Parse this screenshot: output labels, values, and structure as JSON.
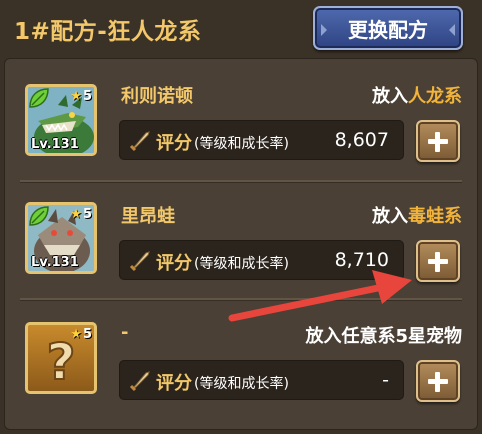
{
  "header": {
    "title": "1#配方-狂人龙系",
    "switch_button": "更换配方"
  },
  "rows": [
    {
      "pet_name": "利则诺顿",
      "level": "Lv.131",
      "stars": "5",
      "target_prefix": "放入",
      "target_highlight": "人龙系",
      "score_label": "评分",
      "score_sub": "(等级和成长率)",
      "score_value": "8,607"
    },
    {
      "pet_name": "里昂蛙",
      "level": "Lv.131",
      "stars": "5",
      "target_prefix": "放入",
      "target_highlight": "毒蛙系",
      "score_label": "评分",
      "score_sub": "(等级和成长率)",
      "score_value": "8,710"
    },
    {
      "pet_name": "-",
      "level": "",
      "stars": "5",
      "target_prefix": "放入任意系5星宠物",
      "target_highlight": "",
      "score_label": "评分",
      "score_sub": "(等级和成长率)",
      "score_value": "-"
    }
  ],
  "icons": {
    "element": "leaf-element-icon",
    "star": "star-icon",
    "score": "sword-icon",
    "add": "plus-icon",
    "unknown": "question-mark-icon"
  },
  "colors": {
    "title_gold": "#f2c86a",
    "highlight": "#f2b43a",
    "annotation_arrow": "#e8453c"
  }
}
